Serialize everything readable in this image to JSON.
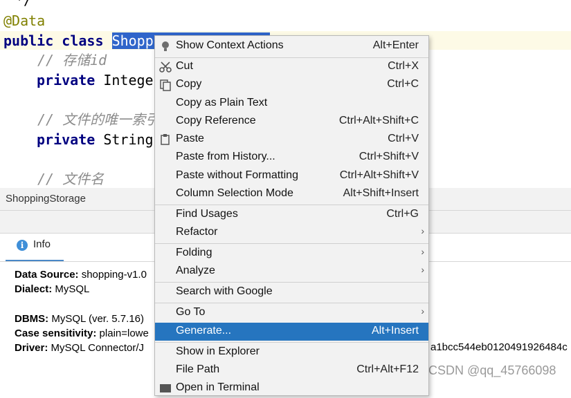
{
  "editor": {
    "lines": {
      "partial_comment": "*/",
      "annotation": "@Data",
      "kw_public": "public",
      "kw_class": "class",
      "class_name_visible": "Shopp",
      "comment_1": "// 存储id",
      "kw_private_1": "private",
      "type_1": "Intege",
      "comment_2": "// 文件的唯一索引",
      "kw_private_2": "private",
      "type_2": "String",
      "comment_3": "// 文件名"
    }
  },
  "db_panel": {
    "title": "ShoppingStorage",
    "tab_label": "Info",
    "tab_icon": "info-icon",
    "info": {
      "data_source_label": "Data Source:",
      "data_source_value": " shopping-v1.0",
      "dialect_label": "Dialect:",
      "dialect_value": " MySQL",
      "dbms_label": "DBMS:",
      "dbms_value": " MySQL (ver. 5.7.16)",
      "case_label": "Case sensitivity:",
      "case_value": " plain=lowe",
      "driver_label": "Driver:",
      "driver_value": " MySQL Connector/J",
      "driver_hash_fragment": "a1bcc544eb0120491926484c"
    }
  },
  "context_menu": {
    "items": [
      {
        "label": "Show Context Actions",
        "shortcut": "Alt+Enter",
        "icon": "lightbulb-icon"
      },
      {
        "label": "Cut",
        "shortcut": "Ctrl+X",
        "icon": "scissors-icon"
      },
      {
        "label": "Copy",
        "shortcut": "Ctrl+C",
        "icon": "copy-icon"
      },
      {
        "label": "Copy as Plain Text",
        "shortcut": ""
      },
      {
        "label": "Copy Reference",
        "shortcut": "Ctrl+Alt+Shift+C"
      },
      {
        "label": "Paste",
        "shortcut": "Ctrl+V",
        "icon": "clipboard-icon"
      },
      {
        "label": "Paste from History...",
        "shortcut": "Ctrl+Shift+V"
      },
      {
        "label": "Paste without Formatting",
        "shortcut": "Ctrl+Alt+Shift+V"
      },
      {
        "label": "Column Selection Mode",
        "shortcut": "Alt+Shift+Insert"
      },
      {
        "label": "Find Usages",
        "shortcut": "Ctrl+G"
      },
      {
        "label": "Refactor",
        "shortcut": "",
        "submenu": true
      },
      {
        "label": "Folding",
        "shortcut": "",
        "submenu": true
      },
      {
        "label": "Analyze",
        "shortcut": "",
        "submenu": true
      },
      {
        "label": "Search with Google",
        "shortcut": ""
      },
      {
        "label": "Go To",
        "shortcut": "",
        "submenu": true
      },
      {
        "label": "Generate...",
        "shortcut": "Alt+Insert",
        "active": true
      },
      {
        "label": "Show in Explorer",
        "shortcut": ""
      },
      {
        "label": "File Path",
        "shortcut": "Ctrl+Alt+F12"
      },
      {
        "label": "Open in Terminal",
        "shortcut": "",
        "icon": "terminal-icon"
      }
    ],
    "submenu_arrow": "›",
    "accent_color": "#2675bf"
  },
  "watermark": "CSDN @qq_45766098"
}
